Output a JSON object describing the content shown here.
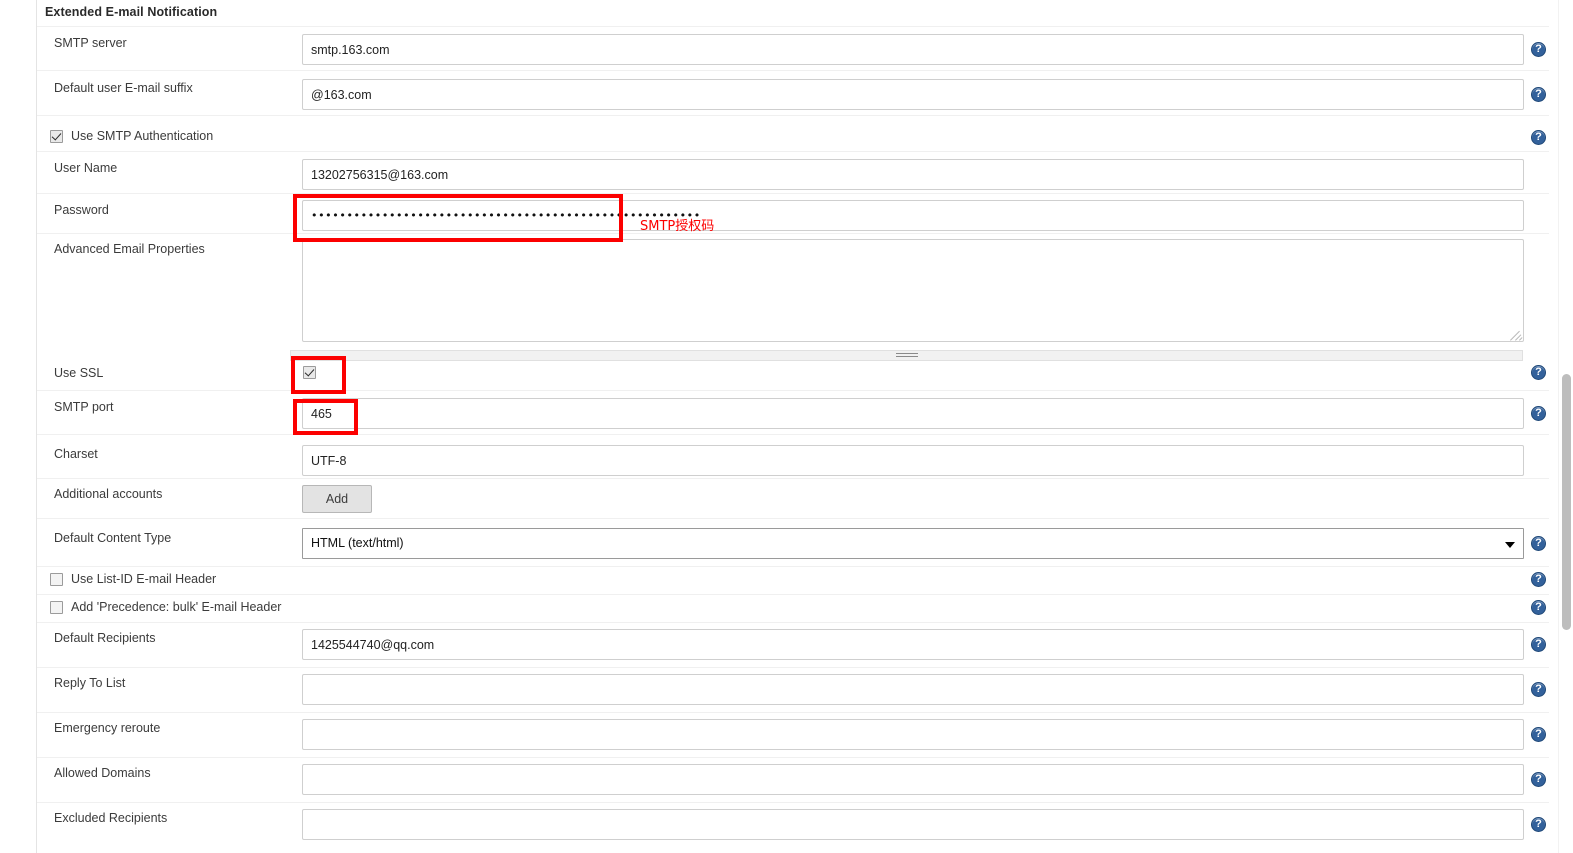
{
  "section": {
    "title": "Extended E-mail Notification"
  },
  "fields": {
    "smtp_server": {
      "label": "SMTP server",
      "value": "smtp.163.com"
    },
    "email_suffix": {
      "label": "Default user E-mail suffix",
      "value": "@163.com"
    },
    "smtp_auth": {
      "label": "Use SMTP Authentication",
      "checked": true
    },
    "user_name": {
      "label": "User Name",
      "value": "13202756315@163.com"
    },
    "password": {
      "label": "Password",
      "value": "•••••••••••••••••••••••••••••••••••••••••••••••••••••••"
    },
    "advanced_props": {
      "label": "Advanced Email Properties",
      "value": ""
    },
    "use_ssl": {
      "label": "Use SSL",
      "checked": true
    },
    "smtp_port": {
      "label": "SMTP port",
      "value": "465"
    },
    "charset": {
      "label": "Charset",
      "value": "UTF-8"
    },
    "additional_accounts": {
      "label": "Additional accounts",
      "button_label": "Add"
    },
    "content_type": {
      "label": "Default Content Type",
      "value": "HTML (text/html)"
    },
    "list_id_header": {
      "label": "Use List-ID E-mail Header",
      "checked": false
    },
    "precedence_header": {
      "label": "Add 'Precedence: bulk' E-mail Header",
      "checked": false
    },
    "default_recipients": {
      "label": "Default Recipients",
      "value": "1425544740@qq.com"
    },
    "reply_to_list": {
      "label": "Reply To List",
      "value": ""
    },
    "emergency_reroute": {
      "label": "Emergency reroute",
      "value": ""
    },
    "allowed_domains": {
      "label": "Allowed Domains",
      "value": ""
    },
    "excluded_recipients": {
      "label": "Excluded Recipients",
      "value": ""
    }
  },
  "annotations": {
    "password_note": "SMTP授权码",
    "highlight_color": "#fc0000"
  },
  "icons": {
    "help": "help-icon",
    "caret": "chevron-down-icon"
  },
  "colors": {
    "help_blue": "#33619b",
    "field_border": "#cfcfcf",
    "text": "#3b3b3b"
  }
}
